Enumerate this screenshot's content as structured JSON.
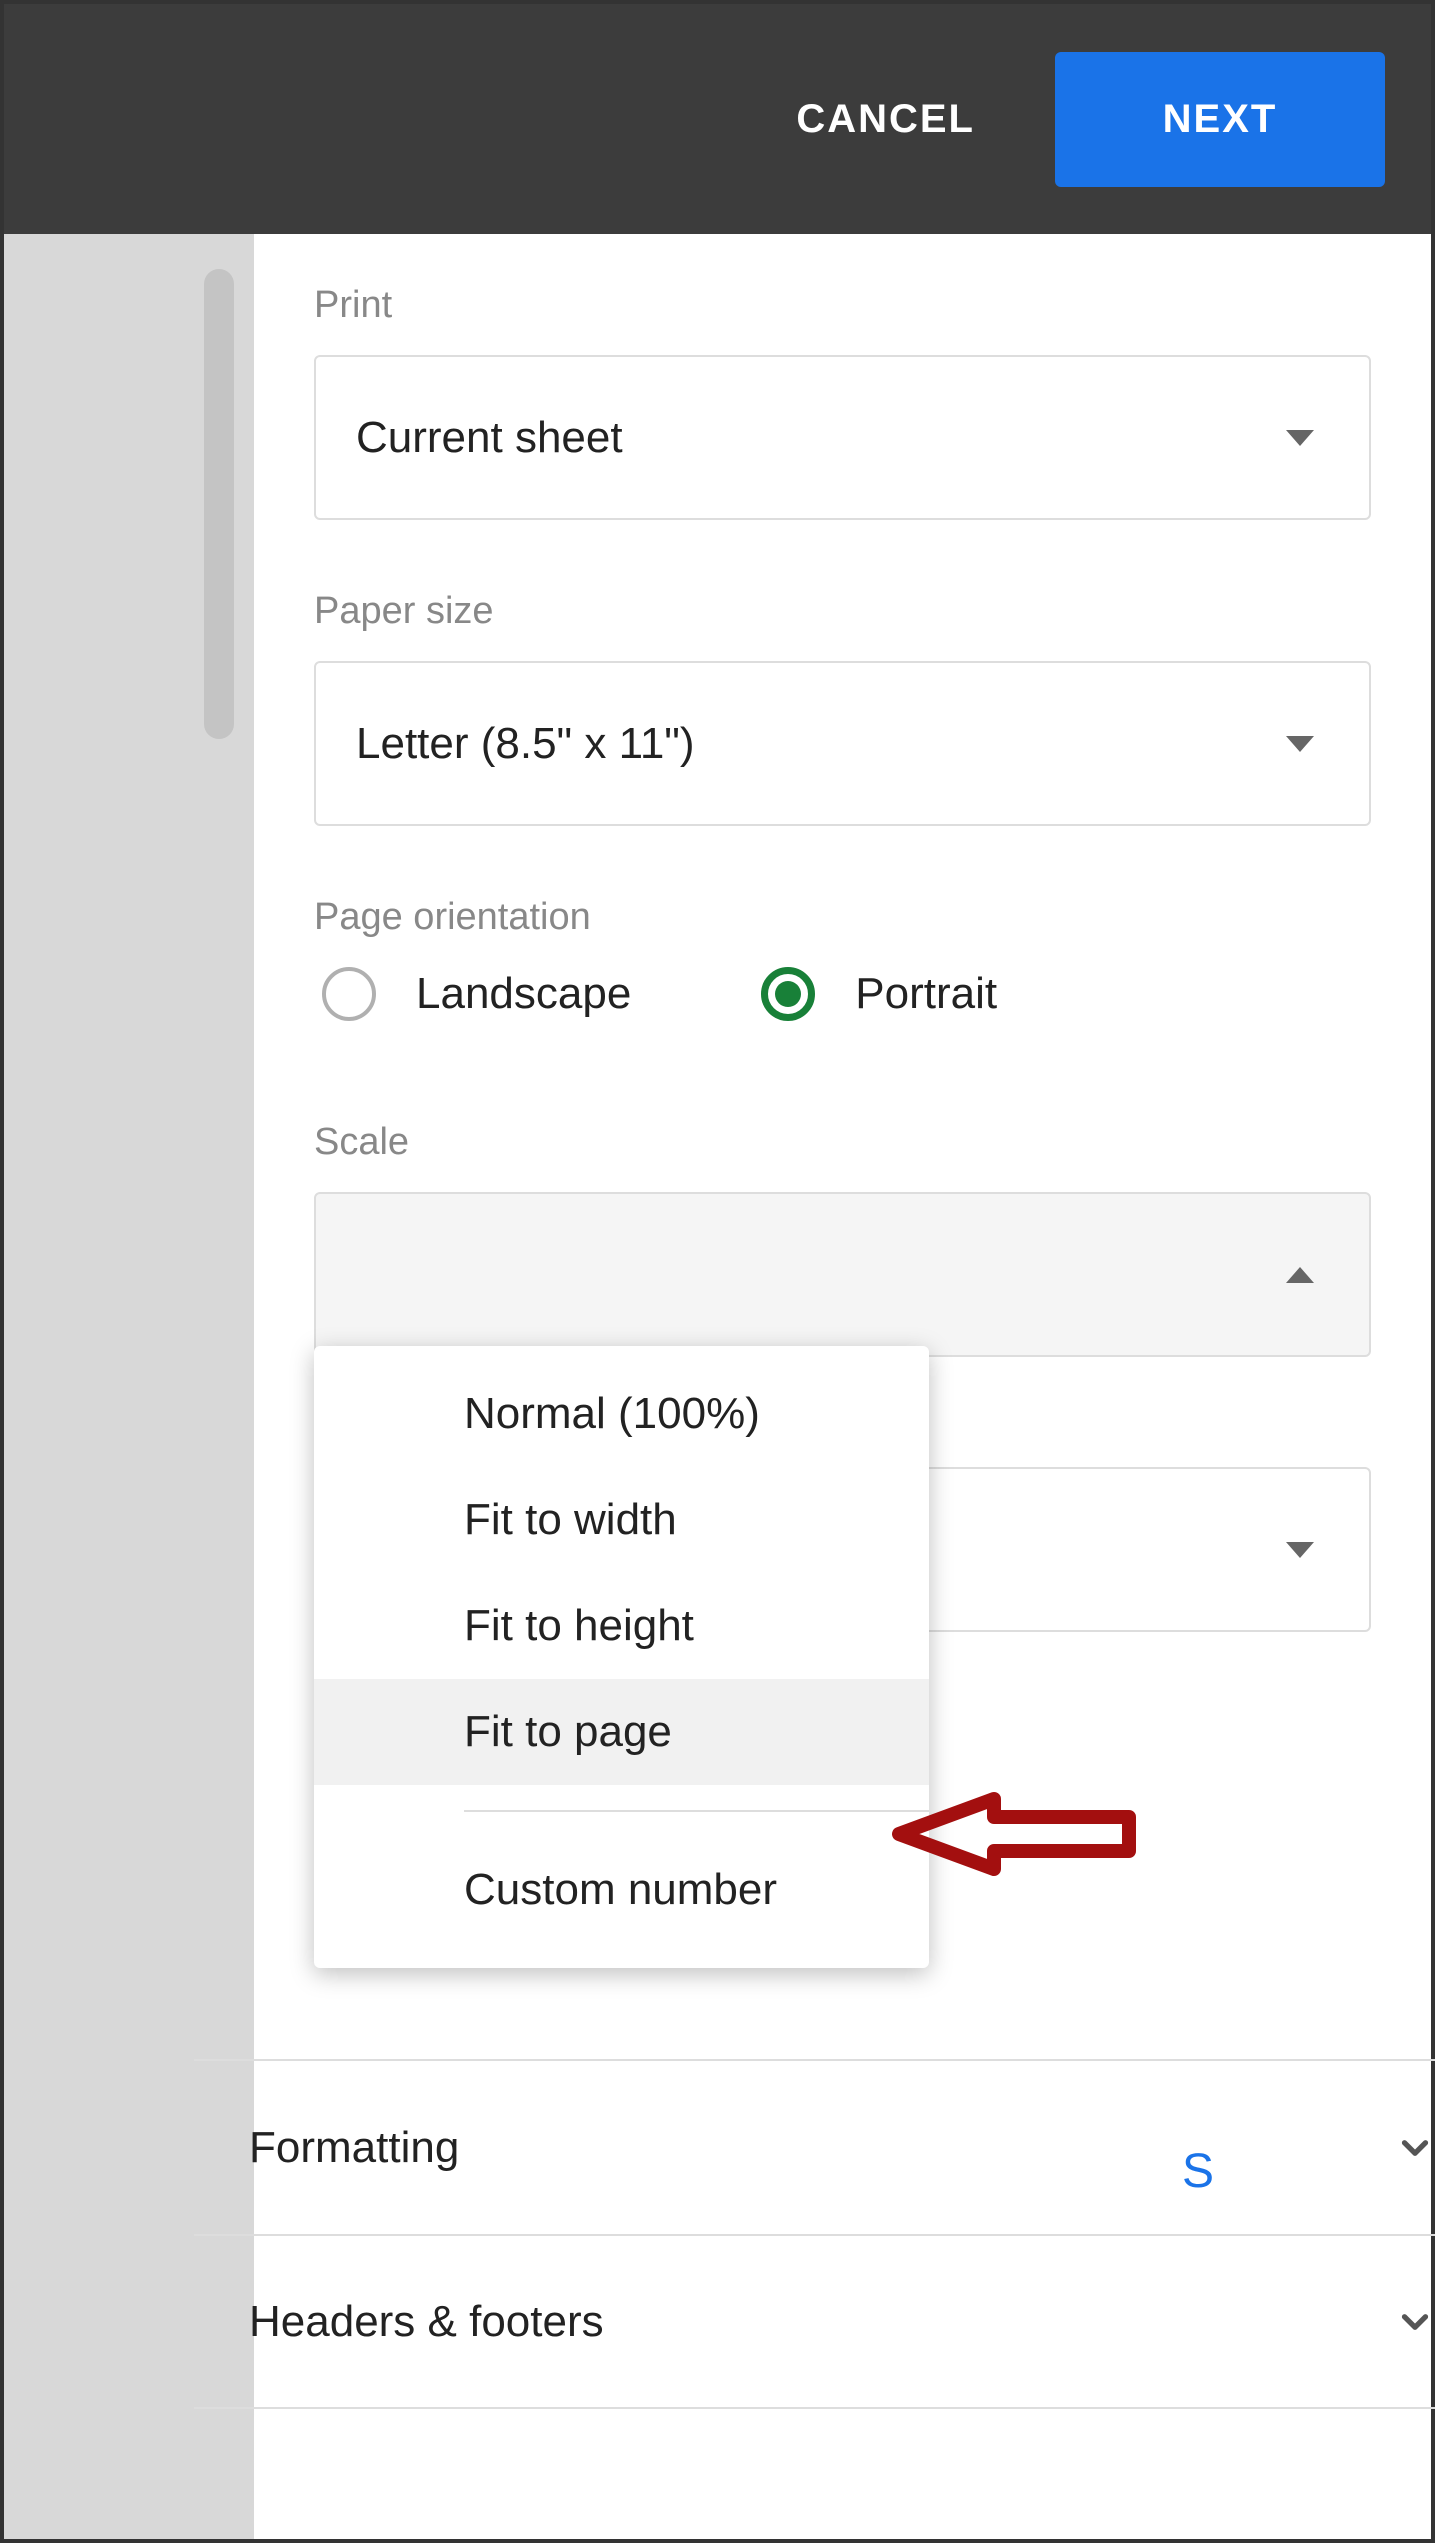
{
  "topbar": {
    "cancel": "CANCEL",
    "next": "NEXT"
  },
  "sections": {
    "print": {
      "label": "Print",
      "value": "Current sheet"
    },
    "paperSize": {
      "label": "Paper size",
      "value": "Letter (8.5\" x 11\")"
    },
    "orientation": {
      "label": "Page orientation",
      "options": [
        "Landscape",
        "Portrait"
      ],
      "selected": "Portrait"
    },
    "scale": {
      "label": "Scale",
      "options": [
        "Normal (100%)",
        "Fit to width",
        "Fit to height",
        "Fit to page",
        "Custom number"
      ],
      "highlighted": "Fit to page"
    },
    "partialLink": "S",
    "formatting": "Formatting",
    "headersFooters": "Headers & footers"
  }
}
